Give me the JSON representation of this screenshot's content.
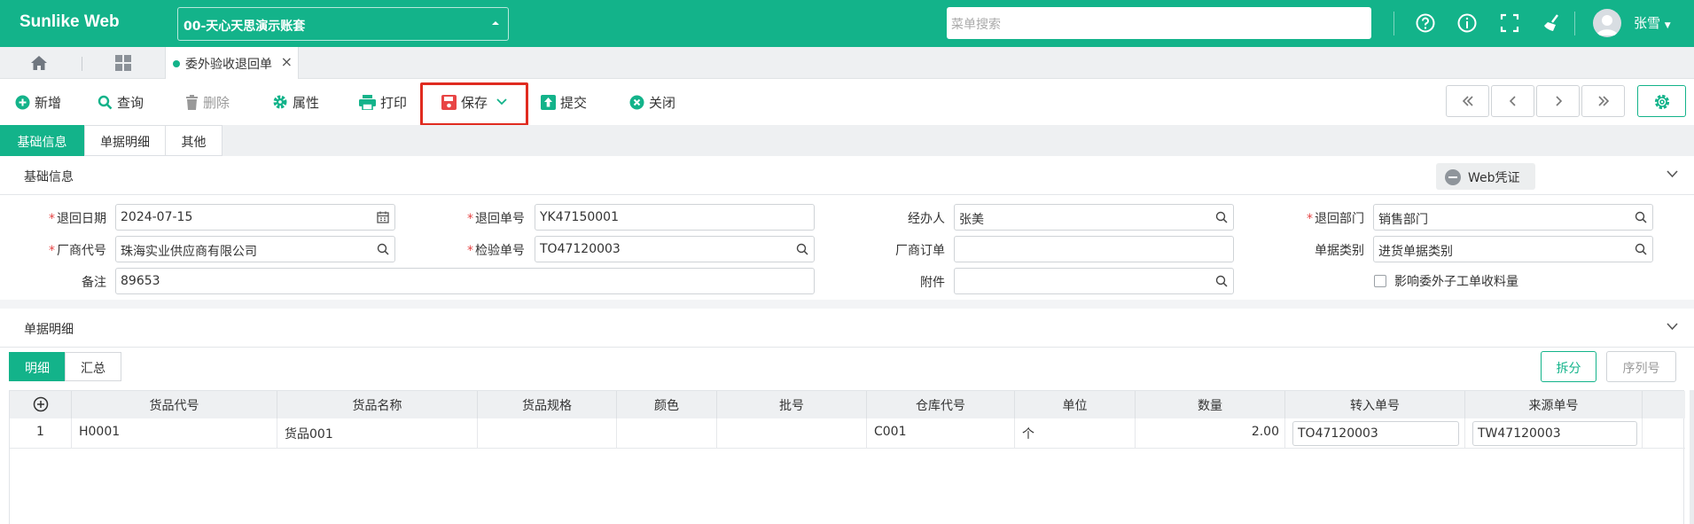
{
  "app": {
    "name": "Sunlike Web",
    "account": "00-天心天思演示账套",
    "search_placeholder": "菜单搜索",
    "user": "张雪"
  },
  "tabs": {
    "doc_tab": "委外验收退回单"
  },
  "toolbar": {
    "add": "新增",
    "query": "查询",
    "delete": "删除",
    "attrs": "属性",
    "print": "打印",
    "save": "保存",
    "submit": "提交",
    "close": "关闭"
  },
  "subtabs": {
    "basic": "基础信息",
    "detail": "单据明细",
    "other": "其他"
  },
  "basic": {
    "title": "基础信息",
    "web_voucher": "Web凭证",
    "fields": {
      "return_date": {
        "label": "退回日期",
        "value": "2024-07-15"
      },
      "return_no": {
        "label": "退回单号",
        "value": "YK47150001"
      },
      "handler": {
        "label": "经办人",
        "value": "张美"
      },
      "return_dept": {
        "label": "退回部门",
        "value": "销售部门"
      },
      "vendor": {
        "label": "厂商代号",
        "value": "珠海实业供应商有限公司"
      },
      "inspect_no": {
        "label": "检验单号",
        "value": "TO47120003"
      },
      "vendor_order": {
        "label": "厂商订单",
        "value": ""
      },
      "doc_type": {
        "label": "单据类别",
        "value": "进货单据类别"
      },
      "remark": {
        "label": "备注",
        "value": "89653"
      },
      "attachment": {
        "label": "附件",
        "value": ""
      },
      "affect": {
        "label": "影响委外子工单收料量",
        "checked": false
      }
    }
  },
  "detail": {
    "title": "单据明细",
    "tab_detail": "明细",
    "tab_summary": "汇总",
    "split": "拆分",
    "serial": "序列号",
    "columns": [
      "货品代号",
      "货品名称",
      "货品规格",
      "颜色",
      "批号",
      "仓库代号",
      "单位",
      "数量",
      "转入单号",
      "来源单号"
    ],
    "rows": [
      {
        "idx": "1",
        "code": "H0001",
        "name": "货品001",
        "spec": "",
        "color": "",
        "batch": "",
        "warehouse": "C001",
        "unit": "个",
        "qty": "2.00",
        "in_no": "TO47120003",
        "src_no": "TW47120003"
      }
    ]
  },
  "colors": {
    "brand": "#13b38a",
    "highlight": "#e02b20"
  }
}
